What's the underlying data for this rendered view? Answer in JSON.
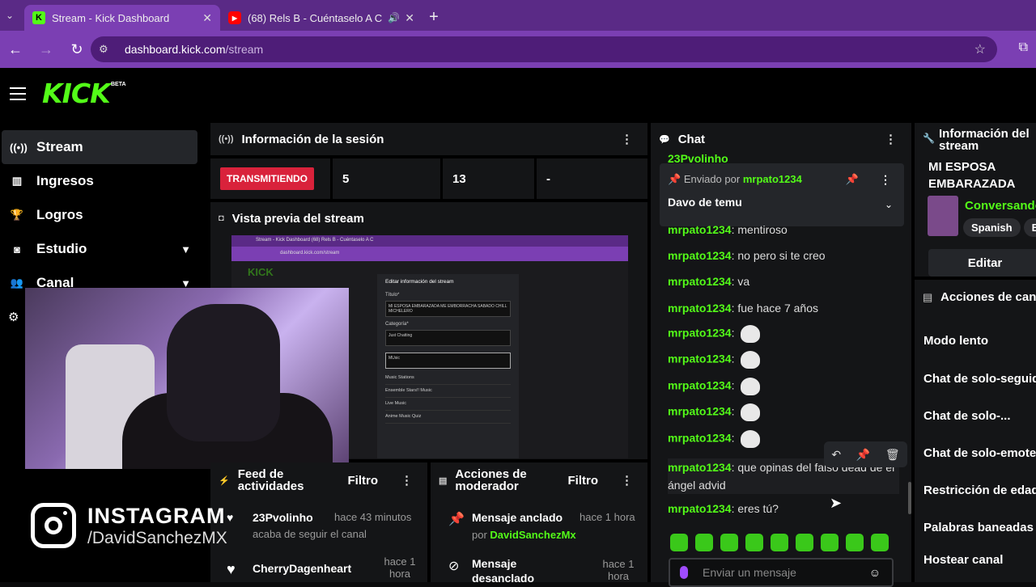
{
  "browser": {
    "tabs": [
      {
        "title": "Stream - Kick Dashboard",
        "active": true
      },
      {
        "title": "(68) Rels B - Cuéntaselo A C",
        "active": false
      }
    ],
    "url_host": "dashboard.kick.com",
    "url_path": "/stream"
  },
  "logo": {
    "text": "KICK",
    "beta": "BETA"
  },
  "sidebar": {
    "items": [
      {
        "label": "Stream",
        "icon": "broadcast-icon"
      },
      {
        "label": "Ingresos",
        "icon": "chart-icon"
      },
      {
        "label": "Logros",
        "icon": "trophy-icon"
      },
      {
        "label": "Estudio",
        "icon": "studio-icon"
      },
      {
        "label": "Canal",
        "icon": "users-icon"
      }
    ]
  },
  "session": {
    "title": "Información de la sesión",
    "status": "TRANSMITIENDO",
    "stat1": "5",
    "stat2": "13",
    "stat3": "-"
  },
  "preview": {
    "title": "Vista previa del stream",
    "mini_tab1": "Stream - Kick Dashboard",
    "mini_tab2": "(68) Rels B - Cuéntaselo A C",
    "mini_url": "dashboard.kick.com/stream",
    "dialog_title": "Editar información del stream",
    "titulo_label": "Título*",
    "titulo_value": "MI ESPOSA EMBARAZADA ME EMBORRACHA SABADO CHILL MICHELERO",
    "categoria_label": "Categoría*",
    "categoria_value": "Just Chatting",
    "search_value": "MUsic",
    "results": [
      "Music Stations",
      "Ensemble Stars!! Music",
      "Live Music",
      "Anime Music Quiz"
    ]
  },
  "feed": {
    "title": "Feed de actividades",
    "filter": "Filtro",
    "items": [
      {
        "user": "23Pvolinho",
        "time": "hace 43 minutos",
        "action": "acaba de seguir el canal"
      },
      {
        "user": "CherryDagenheart",
        "time": "hace 1 hora",
        "action": ""
      }
    ]
  },
  "mod_actions": {
    "title": "Acciones de moderador",
    "filter": "Filtro",
    "items": [
      {
        "title": "Mensaje anclado",
        "time": "hace 1 hora",
        "by_prefix": "por",
        "by_user": "DavidSanchezMx"
      },
      {
        "title": "Mensaje desanclado",
        "time": "hace 1 hora"
      }
    ]
  },
  "chat": {
    "title": "Chat",
    "top_partial_user": "23Pvolinho",
    "pinned": {
      "prefix": "Enviado por",
      "user": "mrpato1234",
      "message": "Davo de temu"
    },
    "messages": [
      {
        "user": "mrpato1234",
        "text": "mentiroso"
      },
      {
        "user": "mrpato1234",
        "text": "no pero si te creo"
      },
      {
        "user": "mrpato1234",
        "text": "va"
      },
      {
        "user": "mrpato1234",
        "text": "fue hace 7 años"
      },
      {
        "user": "mrpato1234",
        "text": ""
      },
      {
        "user": "mrpato1234",
        "text": ""
      },
      {
        "user": "mrpato1234",
        "text": ""
      },
      {
        "user": "mrpato1234",
        "text": ""
      },
      {
        "user": "mrpato1234",
        "text": ""
      },
      {
        "user": "mrpato1234",
        "text": "que opinas del falso dead de el ángel advid"
      },
      {
        "user": "mrpato1234",
        "text": "eres tú?"
      }
    ],
    "input_placeholder": "Enviar un mensaje"
  },
  "stream_info": {
    "title": "Información del stream",
    "stream_title": "MI ESPOSA EMBARAZADA ME...",
    "category": "Conversando",
    "tags": [
      "Spanish",
      "E"
    ],
    "edit": "Editar"
  },
  "channel_actions": {
    "title": "Acciones de canal",
    "items": [
      "Modo lento",
      "Chat de solo-seguidores",
      "Chat de solo-...",
      "Chat de solo-emotes",
      "Restricción de edad",
      "Palabras baneadas",
      "Hostear canal"
    ]
  },
  "overlay": {
    "brand": "INSTAGRAM",
    "handle": "/DavidSanchezMX"
  },
  "colors": {
    "kick_green": "#53fc18",
    "live_red": "#d9223b",
    "browser_purple": "#7b3fb3"
  }
}
